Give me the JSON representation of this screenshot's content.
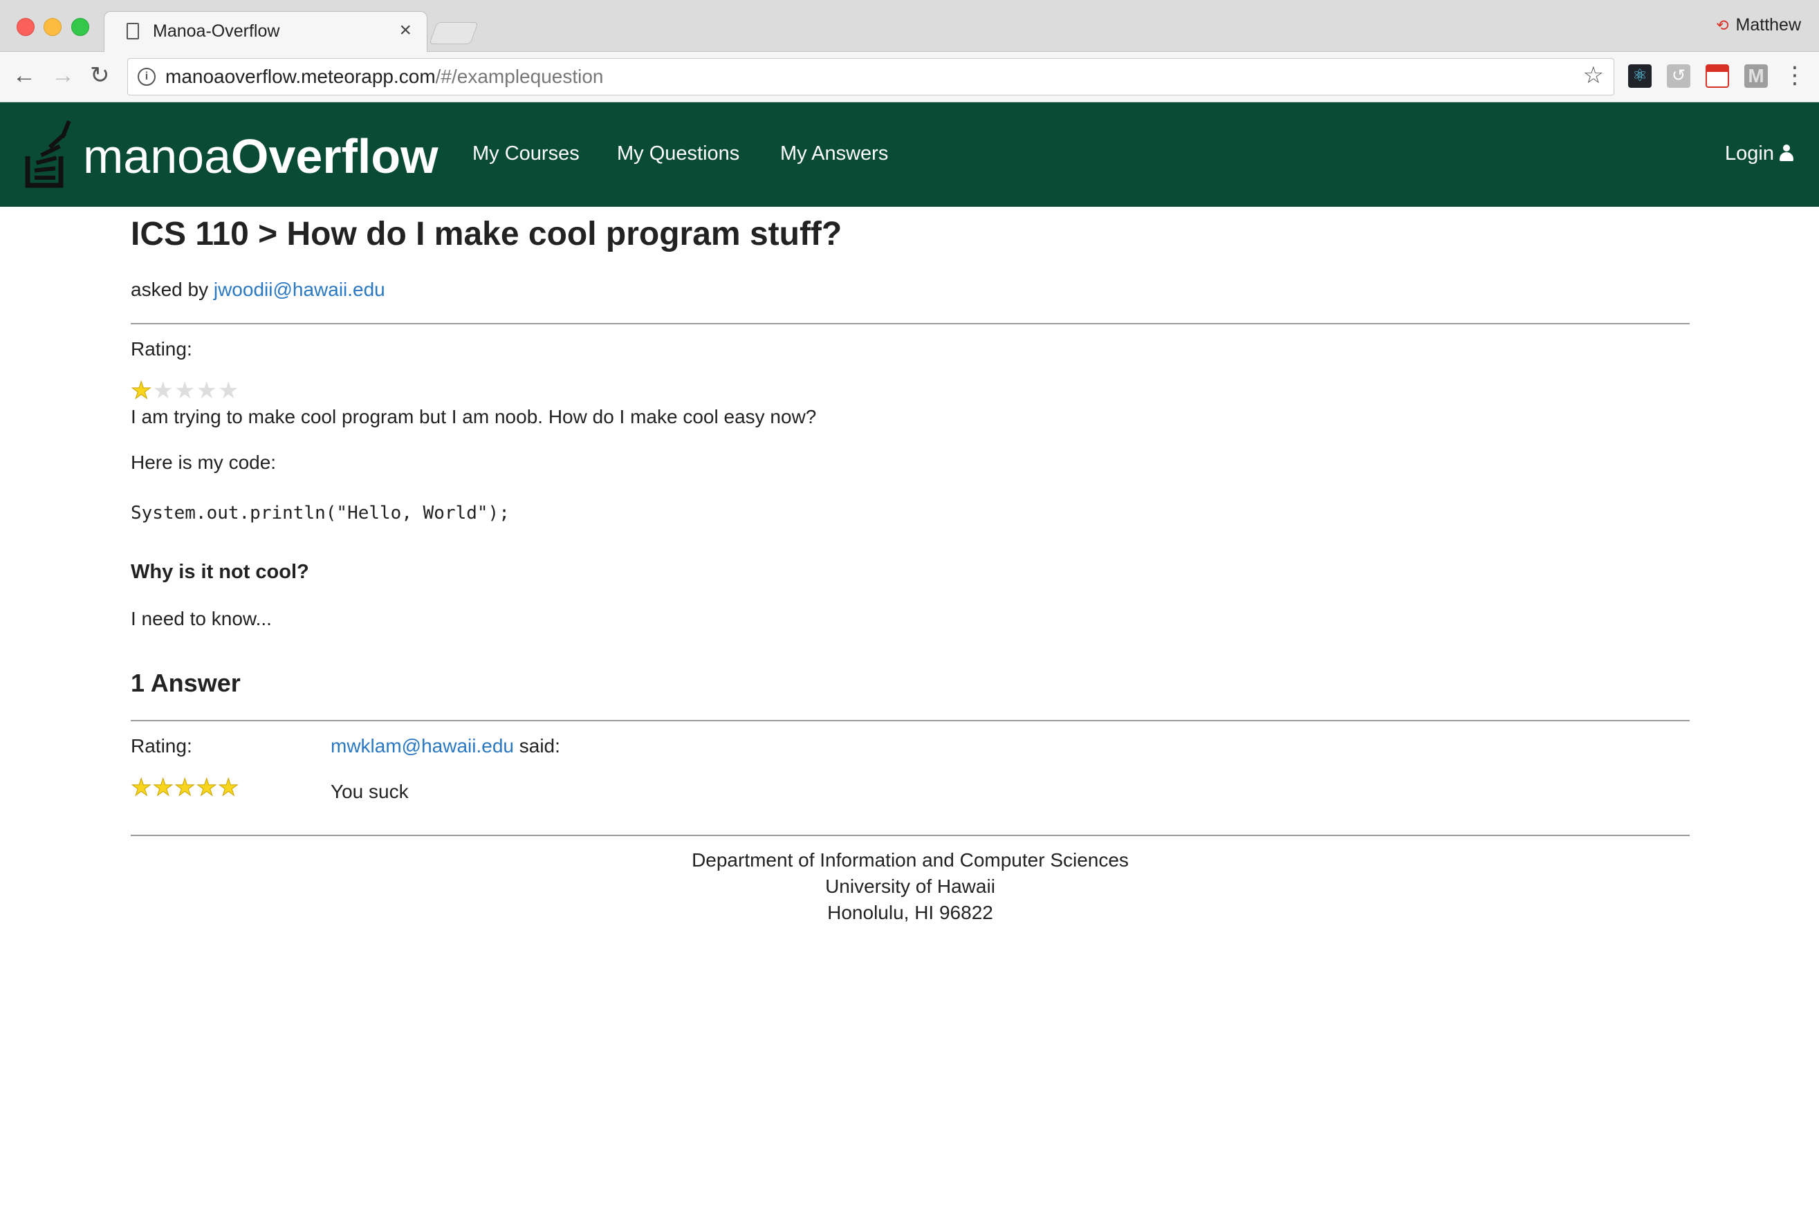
{
  "browser": {
    "tab_title": "Manoa-Overflow",
    "profile_name": "Matthew",
    "url_host": "manoaoverflow.meteorapp.com",
    "url_path": "/#/examplequestion"
  },
  "navbar": {
    "brand_light": "manoa",
    "brand_bold": "Overflow",
    "links": {
      "courses": "My Courses",
      "questions": "My Questions",
      "answers": "My Answers",
      "login": "Login"
    },
    "colors": {
      "background": "#094b35",
      "text": "#ffffff"
    }
  },
  "question": {
    "title": "ICS 110 > How do I make cool program stuff?",
    "asked_by_prefix": "asked by",
    "asked_by_email": "jwoodii@hawaii.edu",
    "rating_label": "Rating:",
    "rating": 1,
    "rating_max": 5,
    "body_line1": "I am trying to make cool program but I am noob. How do I make cool easy now?",
    "body_line2": "Here is my code:",
    "code": "System.out.println(\"Hello, World\");",
    "subheading": "Why is it not cool?",
    "body_line3": "I need to know..."
  },
  "answers": {
    "heading": "1 Answer",
    "items": [
      {
        "rating_label": "Rating:",
        "rating": 5,
        "rating_max": 5,
        "author_email": "mwklam@hawaii.edu",
        "said": "said:",
        "body": "You suck"
      }
    ]
  },
  "footer": {
    "line1": "Department of Information and Computer Sciences",
    "line2": "University of Hawaii",
    "line3": "Honolulu, HI 96822"
  },
  "colors": {
    "link": "#2a78c2",
    "star_on": "#f7d51d",
    "star_off": "#dedede"
  }
}
